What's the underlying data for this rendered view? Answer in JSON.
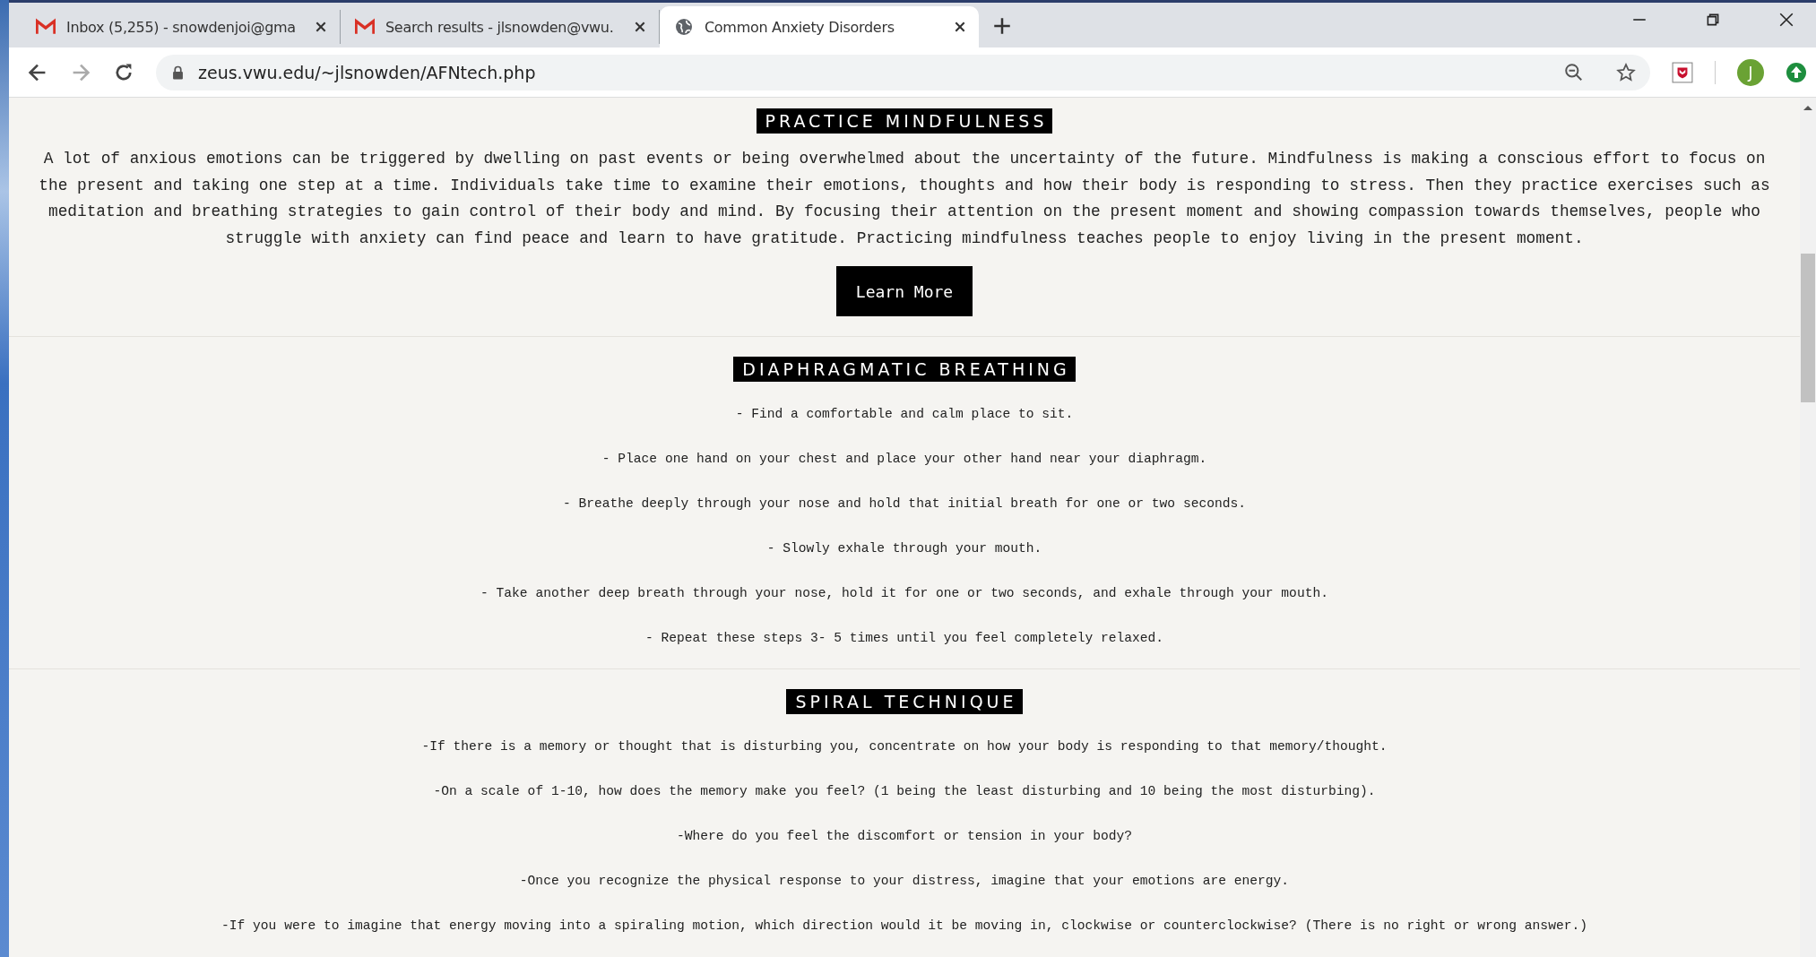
{
  "browser": {
    "tabs": [
      {
        "title": "Inbox (5,255) - snowdenjoi@gma",
        "kind": "mail",
        "selected": false
      },
      {
        "title": "Search results - jlsnowden@vwu.",
        "kind": "mail",
        "selected": false
      },
      {
        "title": "Common Anxiety Disorders",
        "kind": "web",
        "selected": true
      }
    ],
    "address": "zeus.vwu.edu/~jlsnowden/AFNtech.php",
    "profile_initial": "J"
  },
  "sections": [
    {
      "kind": "text",
      "heading": "PRACTICE MINDFULNESS",
      "paragraph": "A lot of anxious emotions can be triggered by dwelling on past events or being overwhelmed about the uncertainty of the future. Mindfulness is making a conscious effort to focus on the present and taking one step at a time. Individuals take time to examine their emotions, thoughts and how their body is responding to stress. Then they practice exercises such as meditation and breathing strategies to gain control of their body and mind. By focusing their attention on the present moment and showing compassion towards themselves, people who struggle with anxiety can find peace and learn to have gratitude. Practicing mindfulness teaches people to enjoy living in the present moment.",
      "button": "Learn More"
    },
    {
      "kind": "steps",
      "heading": "DIAPHRAGMATIC BREATHING",
      "items": [
        "- Find a comfortable and calm place to sit.",
        "- Place one hand on your chest and place your other hand near your diaphragm.",
        "- Breathe deeply through your nose and hold that initial breath for one or two seconds.",
        "- Slowly exhale through your mouth.",
        "- Take another deep breath through your nose, hold it for one or two seconds, and exhale through your mouth.",
        "- Repeat these steps 3- 5 times until you feel completely relaxed."
      ]
    },
    {
      "kind": "steps",
      "heading": "SPIRAL TECHNIQUE",
      "items": [
        "-If there is a memory or thought that is disturbing you, concentrate on how your body is responding to that memory/thought.",
        "-On a scale of 1-10, how does the memory make you feel? (1 being the least disturbing and 10 being the most disturbing).",
        "-Where do you feel the discomfort or tension in your body?",
        "-Once you recognize the physical response to your distress, imagine that your emotions are energy.",
        "-If you were to imagine that energy moving into a spiraling motion, which direction would it be moving in, clockwise or counterclockwise? (There is no right or wrong answer.)"
      ]
    }
  ]
}
